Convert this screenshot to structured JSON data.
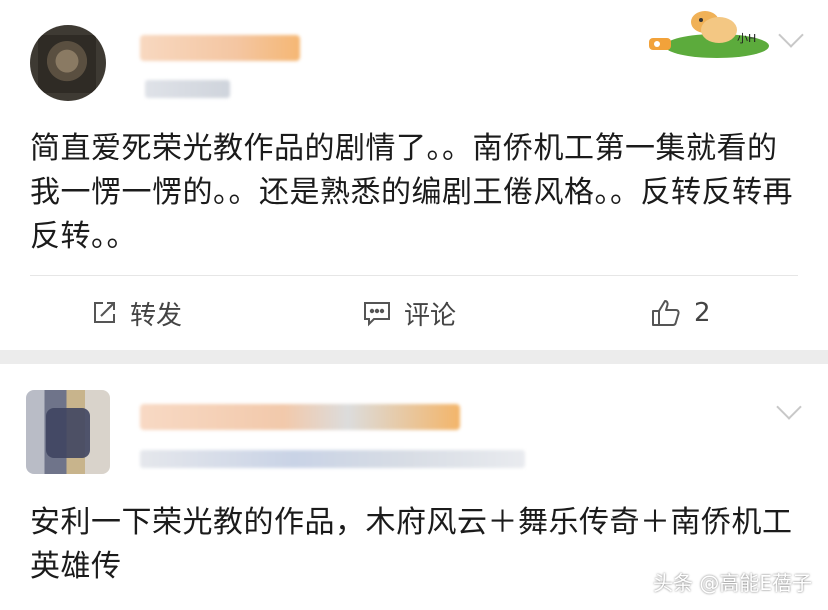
{
  "posts": [
    {
      "content": "简直爱死荣光教作品的剧情了。。南侨机工第一集就看的我一愣一愣的。。还是熟悉的编剧王倦风格。。反转反转再反转。。",
      "actions": {
        "repost_label": "转发",
        "comment_label": "评论",
        "like_count": "2"
      },
      "sticker_text": "小H"
    },
    {
      "content": "安利一下荣光教的作品，木府风云＋舞乐传奇＋南侨机工英雄传"
    }
  ],
  "watermark": "头条 @高能E蓓子",
  "colors": {
    "separator": "#ececec",
    "name_blur": "#f6c9a6",
    "meta_blur": "#d5dae3"
  },
  "icons": [
    "repost-icon",
    "comment-icon",
    "like-icon",
    "chevron-down-icon"
  ]
}
